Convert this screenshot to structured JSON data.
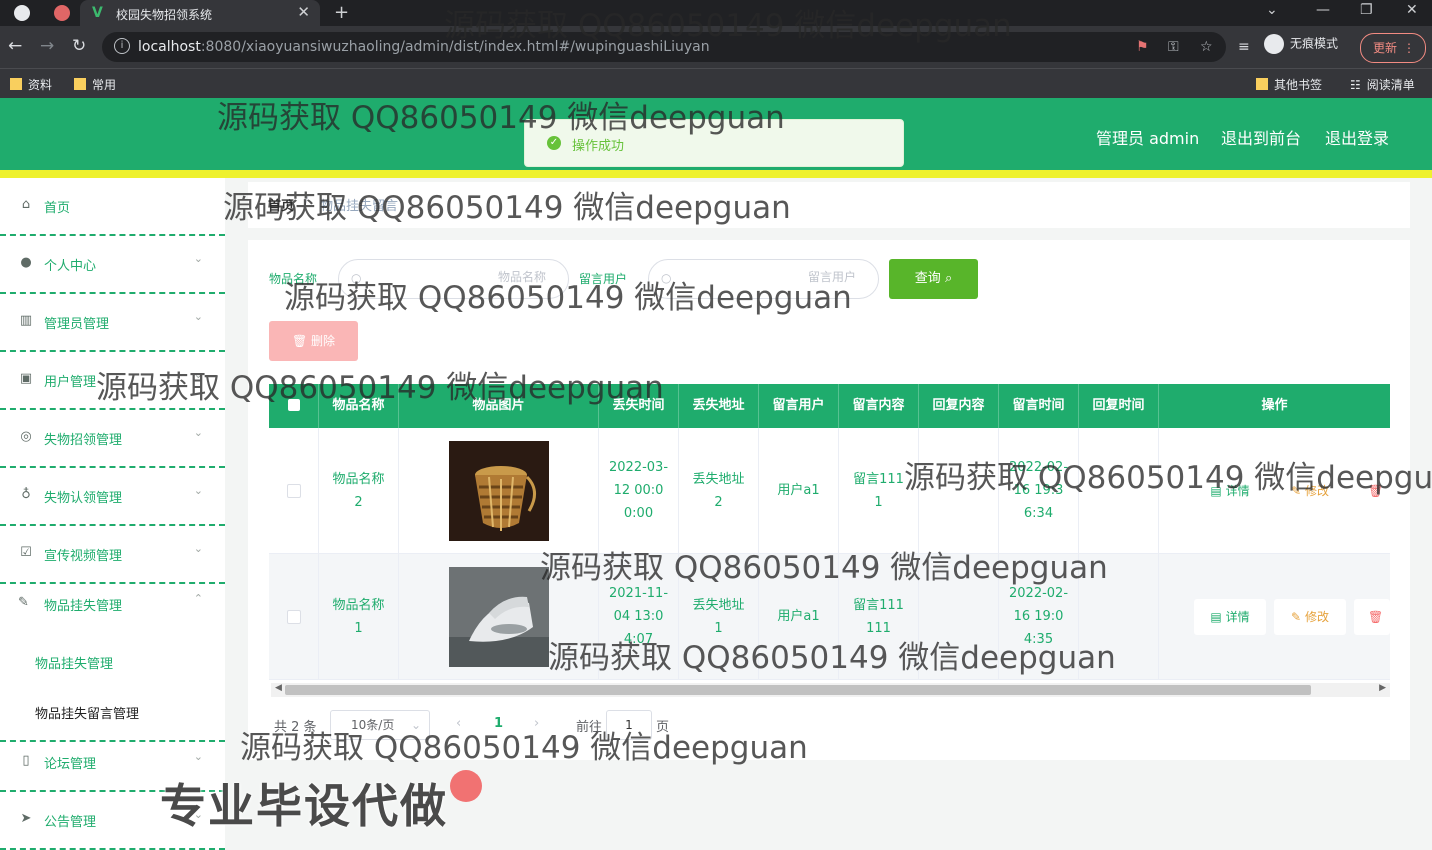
{
  "browser": {
    "tab_title": "校园失物招领系统",
    "tab_close": "✕",
    "new_tab": "+",
    "url_host": "localhost",
    "url_rest": ":8080/xiaoyuansiwuzhaoling/admin/dist/index.html#/wupinguashiLiuyan",
    "incognito": "无痕模式",
    "update": "更新",
    "bookmarks": [
      "资料",
      "常用"
    ],
    "other_bookmarks": "其他书签",
    "reading_list": "阅读清单"
  },
  "header": {
    "admin_label": "管理员 admin",
    "back_front": "退出到前台",
    "logout": "退出登录"
  },
  "toast": "操作成功",
  "sidebar": {
    "items": [
      {
        "label": "首页",
        "icon": "home-icon"
      },
      {
        "label": "个人中心",
        "icon": "user-icon"
      },
      {
        "label": "管理员管理",
        "icon": "books-icon"
      },
      {
        "label": "用户管理",
        "icon": "clipboard-icon"
      },
      {
        "label": "失物招领管理",
        "icon": "target-icon"
      },
      {
        "label": "失物认领管理",
        "icon": "mic-icon"
      },
      {
        "label": "宣传视频管理",
        "icon": "check-clipboard-icon"
      },
      {
        "label": "物品挂失管理",
        "icon": "pen-icon"
      },
      {
        "label": "论坛管理",
        "icon": "phone-icon"
      },
      {
        "label": "公告管理",
        "icon": "send-icon"
      }
    ],
    "sub_items": [
      "物品挂失管理",
      "物品挂失留言管理"
    ]
  },
  "breadcrumb": {
    "home": "首页",
    "current": "物品挂失留言"
  },
  "filters": {
    "name_label": "物品名称",
    "name_placeholder": "物品名称",
    "user_label": "留言用户",
    "user_placeholder": "留言用户",
    "query": "查询",
    "delete": "删除"
  },
  "table": {
    "headers": [
      "物品名称",
      "物品图片",
      "丢失时间",
      "丢失地址",
      "留言用户",
      "留言内容",
      "回复内容",
      "留言时间",
      "回复时间",
      "操作"
    ],
    "rows": [
      {
        "name": "物品名称2",
        "lost_time": "2022-03-12 00:00:00",
        "address": "丢失地址2",
        "user": "用户a1",
        "content": "留言1111",
        "reply": "",
        "msg_time": "2022-02-16 19:36:34",
        "reply_time": ""
      },
      {
        "name": "物品名称1",
        "lost_time": "2021-11-04 13:04:07",
        "address": "丢失地址1",
        "user": "用户a1",
        "content": "留言111111",
        "reply": "",
        "msg_time": "2022-02-16 19:04:35",
        "reply_time": ""
      }
    ],
    "actions": {
      "detail": "详情",
      "edit": "修改",
      "delete": "删"
    }
  },
  "pagination": {
    "total": "共 2 条",
    "page_size": "10条/页",
    "current_page": "1",
    "goto": "前往",
    "goto_value": "1",
    "page_unit": "页"
  },
  "watermark": "源码获取 QQ86050149 微信deepguan",
  "promo": "专业毕设代做",
  "colors": {
    "primary": "#1fac6d",
    "accent_bar": "#eef12d",
    "query": "#58b52a",
    "danger_light": "#fab6b6"
  }
}
